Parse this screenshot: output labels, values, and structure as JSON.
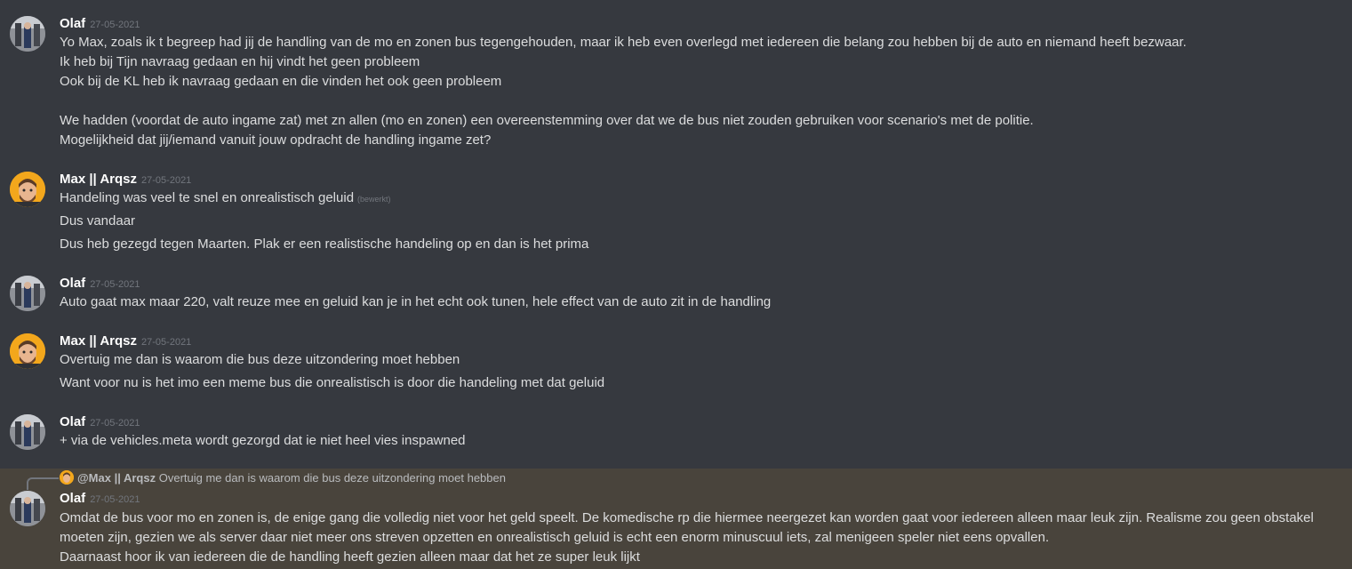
{
  "colors": {
    "background": "#36393f",
    "highlight": "#49443c",
    "username": "#ffffff",
    "timestamp": "#72767d",
    "text": "#dcddde"
  },
  "messages": [
    {
      "author": "Olaf",
      "timestamp": "27-05-2021",
      "avatar": "olaf-avatar",
      "lines": [
        "Yo Max, zoals ik t begreep had jij de handling van de mo en zonen bus tegengehouden, maar ik heb even overlegd met iedereen die belang zou hebben bij de auto en niemand heeft bezwaar.",
        "Ik heb bij Tijn navraag gedaan en hij vindt het geen probleem",
        "Ook bij de KL heb ik navraag gedaan en die vinden het ook geen probleem",
        "We hadden (voordat de auto ingame zat) met zn allen (mo en zonen) een overeenstemming over dat we de bus niet zouden gebruiken voor scenario's met de politie.",
        "Mogelijkheid dat jij/iemand vanuit jouw opdracht de handling ingame zet?"
      ]
    },
    {
      "author": "Max || Arqsz",
      "timestamp": "27-05-2021",
      "avatar": "max-avatar",
      "lines": [
        "Handeling was veel te snel en onrealistisch geluid",
        "Dus vandaar",
        "Dus heb gezegd tegen Maarten. Plak er een realistische handeling op en dan is het prima"
      ],
      "edited_label": "(bewerkt)"
    },
    {
      "author": "Olaf",
      "timestamp": "27-05-2021",
      "avatar": "olaf-avatar",
      "lines": [
        "Auto gaat max maar 220, valt reuze mee en geluid kan je in het echt ook tunen, hele effect van de auto zit in de handling"
      ]
    },
    {
      "author": "Max || Arqsz",
      "timestamp": "27-05-2021",
      "avatar": "max-avatar",
      "lines": [
        "Overtuig me dan is waarom die bus deze uitzondering moet hebben",
        "Want voor nu is het imo een meme bus die onrealistisch is door die handeling met dat geluid"
      ]
    },
    {
      "author": "Olaf",
      "timestamp": "27-05-2021",
      "avatar": "olaf-avatar",
      "lines": [
        "+ via de vehicles.meta wordt gezorgd dat ie niet heel vies inspawned"
      ]
    },
    {
      "author": "Olaf",
      "timestamp": "27-05-2021",
      "avatar": "olaf-avatar",
      "reply": {
        "author": "@Max || Arqsz",
        "text": "Overtuig me dan is waarom die bus deze uitzondering moet hebben"
      },
      "lines": [
        "Omdat de bus voor mo en zonen is, de enige gang die volledig niet voor het geld speelt. De komedische rp die hiermee neergezet kan worden gaat voor iedereen alleen maar leuk zijn. Realisme zou geen obstakel moeten zijn, gezien we als server daar niet meer ons streven opzetten en onrealistisch geluid is echt een enorm minuscuul iets, zal menigeen speler niet eens opvallen.",
        "Daarnaast hoor ik van iedereen die de handling heeft gezien alleen maar dat het ze super leuk lijkt"
      ]
    }
  ]
}
